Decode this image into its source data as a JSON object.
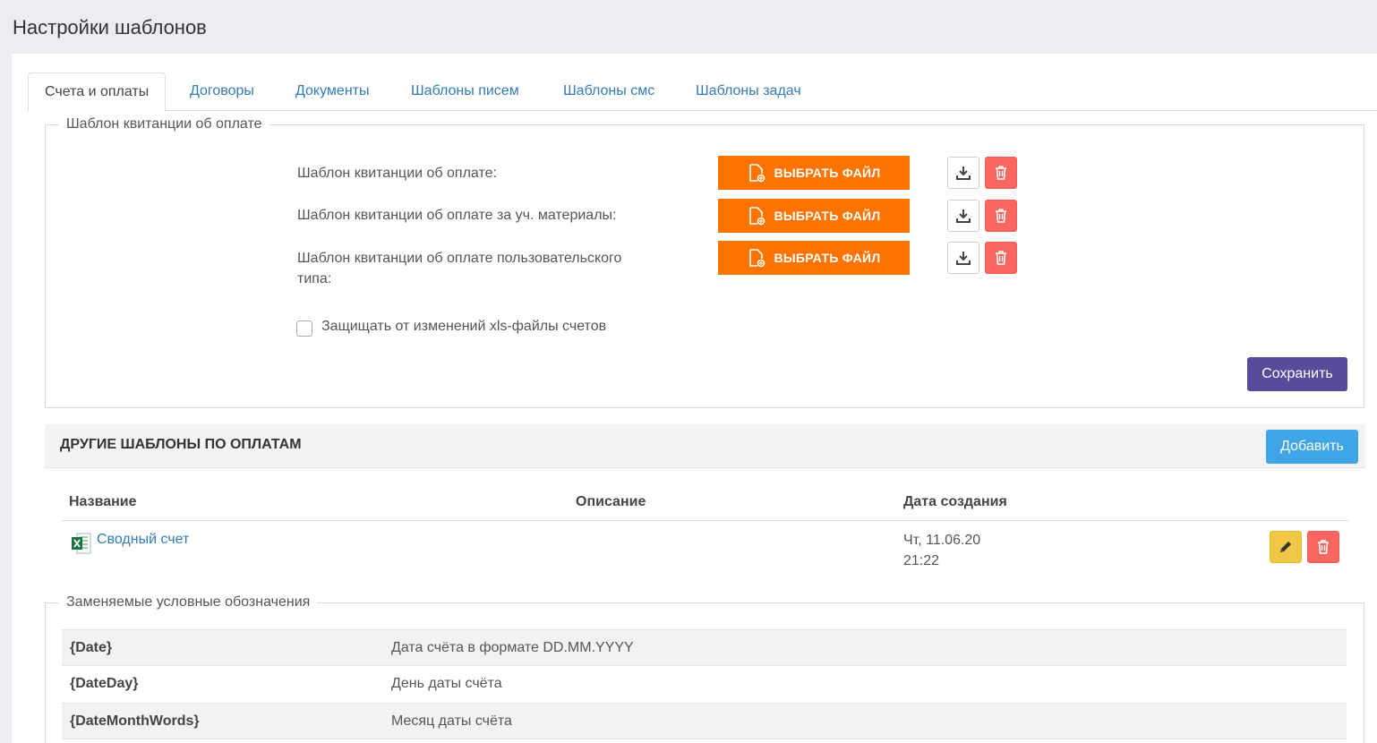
{
  "page": {
    "title": "Настройки шаблонов"
  },
  "tabs": [
    {
      "label": "Счета и оплаты",
      "active": true
    },
    {
      "label": "Договоры"
    },
    {
      "label": "Документы"
    },
    {
      "label": "Шаблоны писем"
    },
    {
      "label": "Шаблоны смс"
    },
    {
      "label": "Шаблоны задач"
    }
  ],
  "receipt_templates": {
    "legend": "Шаблон квитанции об оплате",
    "rows": [
      {
        "label": "Шаблон квитанции об оплате:",
        "button": "ВЫБРАТЬ ФАЙЛ"
      },
      {
        "label": "Шаблон квитанции об оплате за уч. материалы:",
        "button": "ВЫБРАТЬ ФАЙЛ"
      },
      {
        "label": "Шаблон квитанции об оплате пользовательского типа:",
        "button": "ВЫБРАТЬ ФАЙЛ"
      }
    ],
    "protect_checkbox": {
      "label": "Защищать от изменений xls-файлы счетов",
      "checked": false
    },
    "save_label": "Сохранить"
  },
  "other_templates": {
    "title": "ДРУГИЕ ШАБЛОНЫ ПО ОПЛАТАМ",
    "add_label": "Добавить",
    "columns": [
      "Название",
      "Описание",
      "Дата создания"
    ],
    "rows": [
      {
        "name": "Сводный счет",
        "description": "",
        "date_line1": "Чт, 11.06.20",
        "date_line2": "21:22"
      }
    ]
  },
  "variables": {
    "legend": "Заменяемые условные обозначения",
    "rows": [
      {
        "key": "{Date}",
        "desc": "Дата счёта в формате DD.MM.YYYY"
      },
      {
        "key": "{DateDay}",
        "desc": "День даты счёта"
      },
      {
        "key": "{DateMonthWords}",
        "desc": "Месяц даты счёта"
      }
    ]
  },
  "colors": {
    "choose_file": "#ff7300",
    "delete": "#f7675f",
    "save": "#5a4a9a",
    "add": "#3fa5e6",
    "edit": "#f0c846",
    "link": "#337ab7"
  }
}
